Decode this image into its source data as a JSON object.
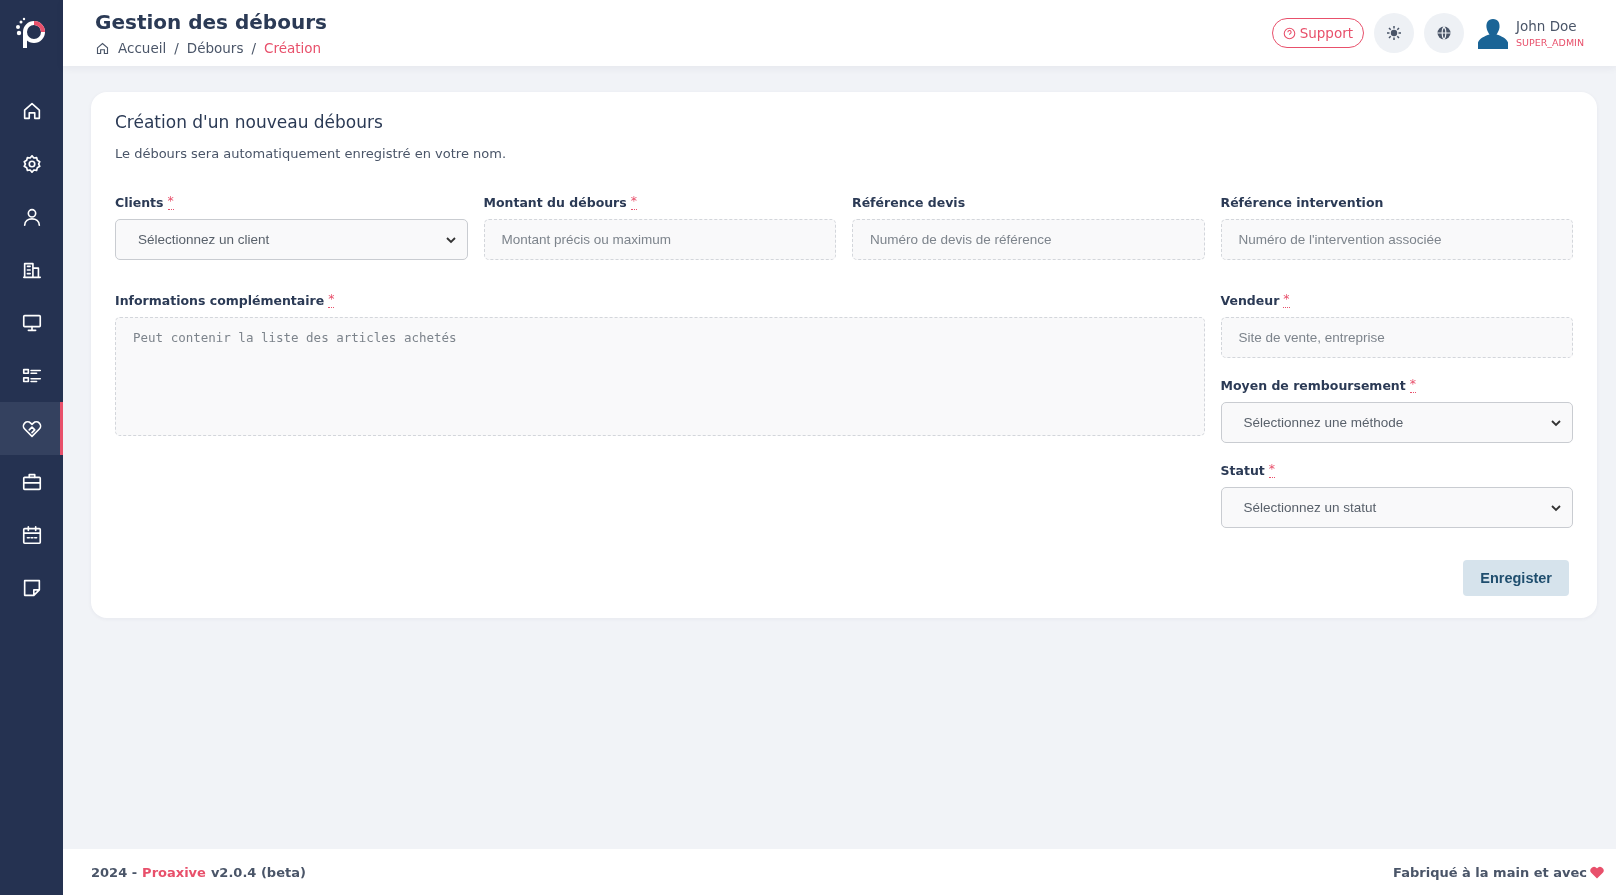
{
  "header": {
    "title": "Gestion des débours",
    "breadcrumb": [
      {
        "label": "Accueil",
        "kind": "home",
        "current": false
      },
      {
        "separator": "/",
        "label": "Débours",
        "kind": "link",
        "current": false
      },
      {
        "separator": "/",
        "label": "Création",
        "kind": "link",
        "current": true
      }
    ],
    "support": "Support",
    "user": {
      "name": "John Doe",
      "role": "SUPER_ADMIN"
    }
  },
  "sidebar": {
    "items": [
      {
        "kind": "home",
        "selected": false
      },
      {
        "kind": "gear",
        "selected": false
      },
      {
        "kind": "user",
        "selected": false
      },
      {
        "kind": "building",
        "selected": false
      },
      {
        "kind": "monitor",
        "selected": false
      },
      {
        "kind": "list",
        "selected": false
      },
      {
        "kind": "heart",
        "selected": true
      },
      {
        "kind": "briefcase",
        "selected": false
      },
      {
        "kind": "calendar",
        "selected": false
      },
      {
        "kind": "note",
        "selected": false
      }
    ]
  },
  "form": {
    "title": "Création d'un nouveau débours",
    "subtitle": "Le débours sera automatiquement enregistré en votre nom.",
    "top_fields": [
      {
        "label": "Clients",
        "required_mark": "*",
        "kind": "select",
        "placeholder": "Sélectionnez un client"
      },
      {
        "label": "Montant du débours",
        "required_mark": "*",
        "kind": "input",
        "placeholder": "Montant précis ou maximum"
      },
      {
        "label": "Référence devis",
        "kind": "input",
        "placeholder": "Numéro de devis de référence"
      },
      {
        "label": "Référence intervention",
        "kind": "input",
        "placeholder": "Numéro de l'intervention associée"
      }
    ],
    "main_fields": [
      {
        "label": "Informations complémentaire",
        "required_mark": "*",
        "kind": "textarea",
        "placeholder": "Peut contenir la liste des articles achetés"
      }
    ],
    "side_fields": [
      {
        "label": "Vendeur",
        "required_mark": "*",
        "kind": "input",
        "placeholder": "Site de vente, entreprise"
      },
      {
        "label": "Moyen de remboursement",
        "required_mark": "*",
        "kind": "select",
        "placeholder": "Sélectionnez une méthode"
      },
      {
        "label": "Statut",
        "required_mark": "*",
        "kind": "select",
        "placeholder": "Sélectionnez un statut"
      }
    ],
    "submit": "Enregister"
  },
  "footer": {
    "year": "2024 -",
    "brand": "Proaxive",
    "version": "v2.0.4 (beta)",
    "made_with": "Fabriqué à la main et avec"
  }
}
